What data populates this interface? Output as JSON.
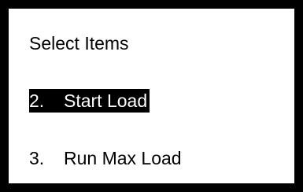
{
  "screen": {
    "title": "Select Items",
    "items": [
      {
        "number": "2.",
        "label": "Start Load",
        "selected": true
      },
      {
        "number": "3.",
        "label": "Run Max Load",
        "selected": false
      }
    ]
  },
  "colors": {
    "frame": "#000000",
    "background": "#ffffff",
    "highlight_bg": "#000000",
    "highlight_text": "#ffffff"
  }
}
